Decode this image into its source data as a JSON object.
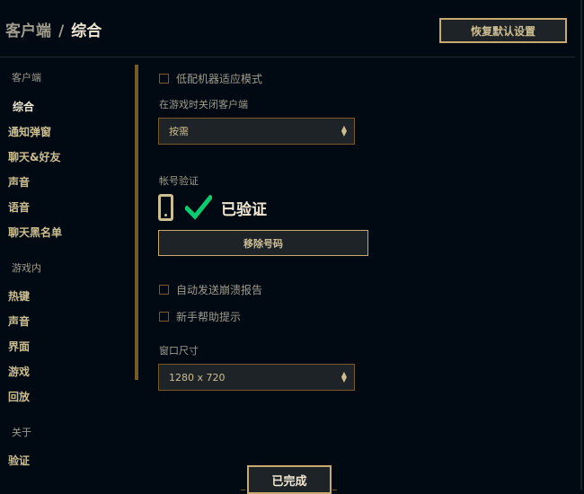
{
  "header": {
    "breadcrumb_parent": "客户端",
    "separator": "/",
    "breadcrumb_current": "综合",
    "reset_label": "恢复默认设置"
  },
  "sidebar": {
    "groups": [
      {
        "title": "客户端",
        "items": [
          "综合",
          "通知弹窗",
          "聊天&好友",
          "声音",
          "语音",
          "聊天黑名单"
        ]
      },
      {
        "title": "游戏内",
        "items": [
          "热键",
          "声音",
          "界面",
          "游戏",
          "回放"
        ]
      },
      {
        "title": "关于",
        "items": [
          "验证"
        ]
      }
    ],
    "active_item": "综合"
  },
  "main": {
    "low_spec_label": "低配机器适应模式",
    "close_client_label": "在游戏时关闭客户端",
    "close_client_value": "按需",
    "account_label": "帐号验证",
    "verified_text": "已验证",
    "remove_number_label": "移除号码",
    "crash_report_label": "自动发送崩溃报告",
    "tips_label": "新手帮助提示",
    "window_size_label": "窗口尺寸",
    "window_size_value": "1280 x 720"
  },
  "footer": {
    "done_label": "已完成"
  },
  "colors": {
    "background": "#010a13",
    "gold": "#c8aa6e",
    "gold_dark": "#785a28",
    "text_light": "#f0e6d2",
    "text_gold": "#cdbe91",
    "check_green": "#0acb6d"
  }
}
